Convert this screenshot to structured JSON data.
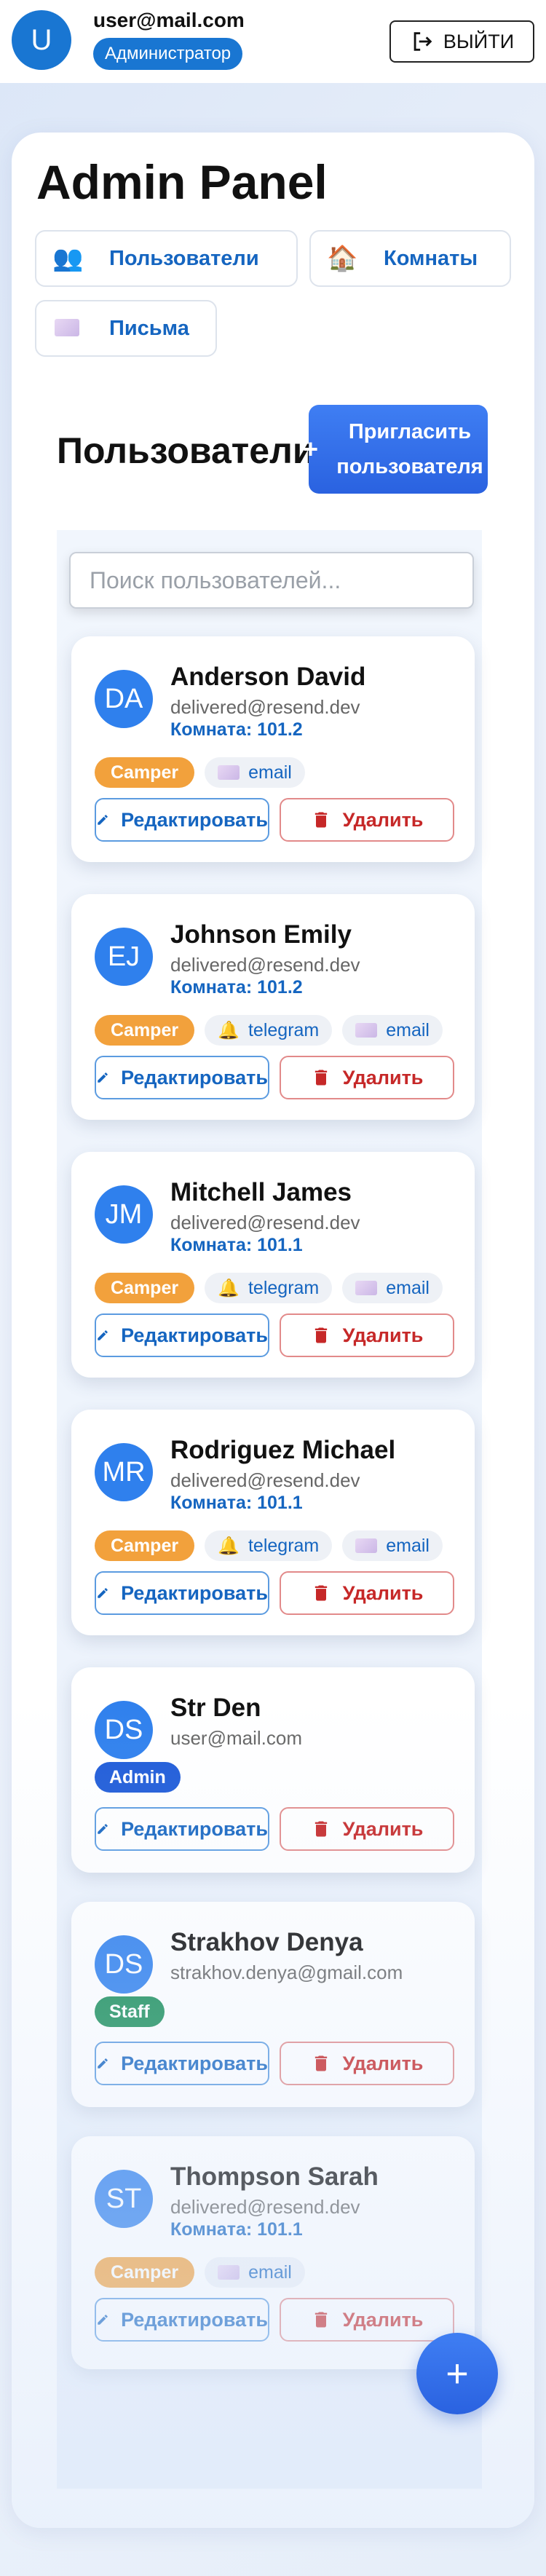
{
  "header": {
    "avatar_letter": "U",
    "email": "user@mail.com",
    "role": "Администратор",
    "logout_label": "ВЫЙТИ"
  },
  "page": {
    "title": "Admin Panel",
    "tabs": [
      {
        "label": "Пользователи",
        "icon": "users-icon",
        "glyph": "👥"
      },
      {
        "label": "Комнаты",
        "icon": "house-icon",
        "glyph": "🏠"
      },
      {
        "label": "Письма",
        "icon": "envelope-icon"
      }
    ],
    "section_title": "Пользователи",
    "invite_label": "Пригласить пользователя",
    "search_placeholder": "Поиск пользователей...",
    "fab_label": "+"
  },
  "users": [
    {
      "initials": "DA",
      "name": "Anderson David",
      "email": "delivered@resend.dev",
      "room": "Комната: 101.2",
      "role": "Camper",
      "channels": [
        "email"
      ]
    },
    {
      "initials": "EJ",
      "name": "Johnson Emily",
      "email": "delivered@resend.dev",
      "room": "Комната: 101.2",
      "role": "Camper",
      "channels": [
        "telegram",
        "email"
      ]
    },
    {
      "initials": "JM",
      "name": "Mitchell James",
      "email": "delivered@resend.dev",
      "room": "Комната: 101.1",
      "role": "Camper",
      "channels": [
        "telegram",
        "email"
      ]
    },
    {
      "initials": "MR",
      "name": "Rodriguez Michael",
      "email": "delivered@resend.dev",
      "room": "Комната: 101.1",
      "role": "Camper",
      "channels": [
        "telegram",
        "email"
      ]
    },
    {
      "initials": "DS",
      "name": "Str Den",
      "email": "user@mail.com",
      "role": "Admin",
      "channels": []
    },
    {
      "initials": "DS",
      "name": "Strakhov Denya",
      "email": "strakhov.denya@gmail.com",
      "role": "Staff",
      "channels": []
    },
    {
      "initials": "ST",
      "name": "Thompson Sarah",
      "email": "delivered@resend.dev",
      "room": "Комната: 101.1",
      "role": "Camper",
      "channels": [
        "email"
      ]
    }
  ],
  "card_actions": {
    "edit_label": "Редактировать",
    "delete_label": "Удалить"
  },
  "colors": {
    "primary": "#1976d2",
    "accent": "#2f80ed",
    "camper": "#f2a13c",
    "admin": "#1e5bd8",
    "staff": "#1a8f5a",
    "danger": "#c62828"
  }
}
